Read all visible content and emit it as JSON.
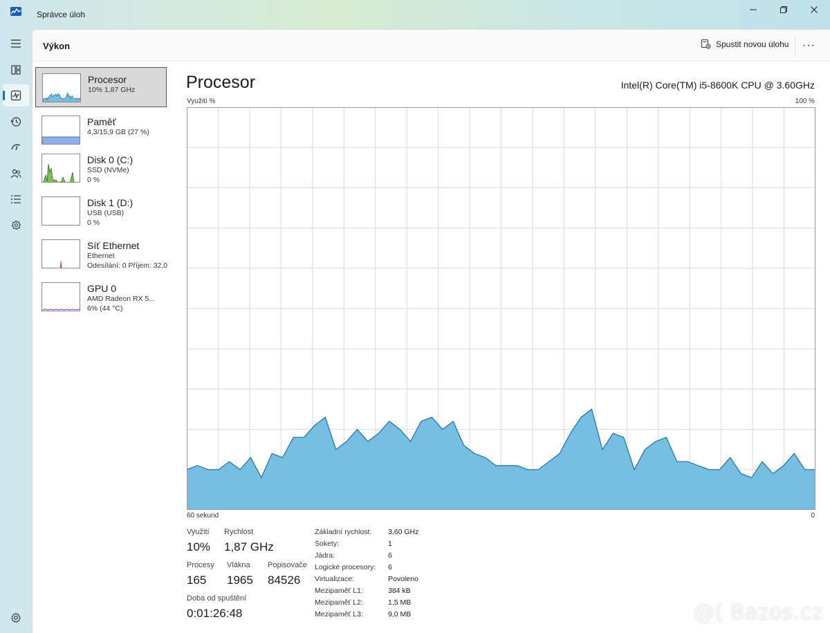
{
  "app": {
    "title": "Správce úloh"
  },
  "header": {
    "title": "Výkon",
    "run_task_label": "Spustit novou úlohu",
    "more_label": "···"
  },
  "resources": [
    {
      "name": "Procesor",
      "sub1": "10%  1,87 GHz",
      "sub2": ""
    },
    {
      "name": "Paměť",
      "sub1": "4,3/15,9 GB (27 %)",
      "sub2": ""
    },
    {
      "name": "Disk 0 (C:)",
      "sub1": "SSD (NVMe)",
      "sub2": "0 %"
    },
    {
      "name": "Disk 1 (D:)",
      "sub1": "USB (USB)",
      "sub2": "0 %"
    },
    {
      "name": "Síť Ethernet",
      "sub1": "Ethernet",
      "sub2": "Odesílání: 0 Příjem: 32,0"
    },
    {
      "name": "GPU 0",
      "sub1": "AMD Radeon RX 5...",
      "sub2": "6%  (44 °C)"
    }
  ],
  "detail": {
    "title": "Procesor",
    "model": "Intel(R) Core(TM) i5-8600K CPU @ 3.60GHz",
    "axis_y_label": "Využití %",
    "axis_y_max": "100 %",
    "axis_x_left": "60 sekund",
    "axis_x_right": "0"
  },
  "stats": {
    "utilization_label": "Využití",
    "utilization_value": "10%",
    "speed_label": "Rychlost",
    "speed_value": "1,87 GHz",
    "processes_label": "Procesy",
    "processes_value": "165",
    "threads_label": "Vlákna",
    "threads_value": "1965",
    "handles_label": "Popisovače",
    "handles_value": "84526",
    "uptime_label": "Doba od spuštění",
    "uptime_value": "0:01:26:48"
  },
  "specs": [
    {
      "label": "Základní rychlost:",
      "value": "3,60 GHz"
    },
    {
      "label": "Sokety:",
      "value": "1"
    },
    {
      "label": "Jádra:",
      "value": "6"
    },
    {
      "label": "Logické procesory:",
      "value": "6"
    },
    {
      "label": "Virtualizace:",
      "value": "Povoleno"
    },
    {
      "label": "Mezipaměť L1:",
      "value": "384 kB"
    },
    {
      "label": "Mezipaměť L2:",
      "value": "1,5 MB"
    },
    {
      "label": "Mezipaměť L3:",
      "value": "9,0 MB"
    }
  ],
  "colors": {
    "cpu_fill": "#76bfe3",
    "cpu_stroke": "#1c6fa3",
    "mem_fill": "#8fb0e8",
    "disk_fill": "#7fbf5a",
    "net_stroke": "#c2445f",
    "gpu_stroke": "#9b5ac2",
    "grid": "#d9d9d9"
  },
  "chart_data": {
    "type": "area",
    "xlabel": "60 sekund",
    "ylabel": "Využití %",
    "ylim": [
      0,
      100
    ],
    "xlim": [
      60,
      0
    ],
    "grid": true,
    "series": [
      {
        "values": [
          10,
          11,
          10,
          10,
          12,
          10,
          13,
          8,
          14,
          13,
          18,
          18,
          21,
          23,
          15,
          17,
          20,
          17,
          19,
          22,
          20,
          17,
          22,
          23,
          20,
          22,
          16,
          14,
          13,
          11,
          11,
          11,
          10,
          10,
          12,
          14,
          19,
          23,
          25,
          15,
          19,
          18,
          10,
          15,
          17,
          18,
          12,
          12,
          11,
          10,
          10,
          13,
          9,
          8,
          12,
          9,
          11,
          14,
          10,
          10
        ]
      }
    ]
  },
  "watermark": "@( Bazos.cz"
}
